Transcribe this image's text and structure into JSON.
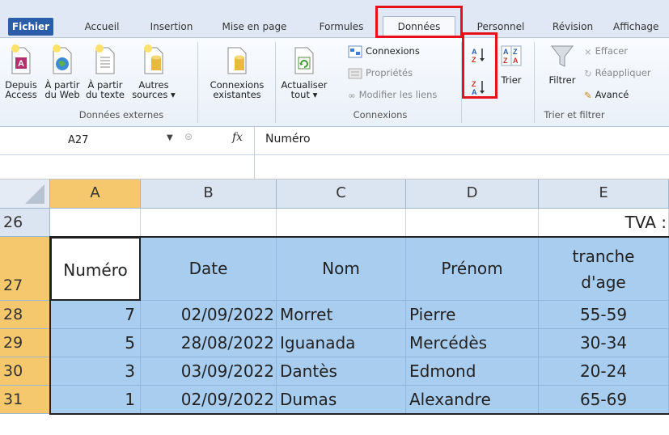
{
  "tabs": {
    "items": [
      "Fichier",
      "Accueil",
      "Insertion",
      "Mise en page",
      "Formules",
      "Données",
      "Personnel",
      "Révision",
      "Affichage"
    ],
    "active": "Données"
  },
  "ribbon": {
    "donnees_externes": {
      "label": "Données externes",
      "buttons": [
        {
          "line1": "Depuis",
          "line2": "Access"
        },
        {
          "line1": "À partir",
          "line2": "du Web"
        },
        {
          "line1": "À partir",
          "line2": "du texte"
        },
        {
          "line1": "Autres",
          "line2": "sources ▾"
        },
        {
          "line1": "Connexions",
          "line2": "existantes"
        }
      ]
    },
    "connexions": {
      "label": "Connexions",
      "refresh": {
        "line1": "Actualiser",
        "line2": "tout ▾"
      },
      "items": [
        "Connexions",
        "Propriétés",
        "Modifier les liens"
      ]
    },
    "trier_filtrer": {
      "label": "Trier et filtrer",
      "sort_button": "Trier",
      "filter_button": "Filtrer",
      "items": [
        "Effacer",
        "Réappliquer",
        "Avancé"
      ]
    }
  },
  "formula_bar": {
    "name_box": "A27",
    "fx": "fx",
    "content": "Numéro"
  },
  "grid": {
    "columns": [
      "A",
      "B",
      "C",
      "D",
      "E"
    ],
    "rows": [
      {
        "num": "26",
        "cells": [
          "",
          "",
          "",
          "",
          "TVA :"
        ]
      },
      {
        "num": "27",
        "cells": [
          "Numéro",
          "Date",
          "Nom",
          "Prénom",
          "tranche d'age"
        ],
        "e_line1": "tranche",
        "e_line2": "d'age"
      },
      {
        "num": "28",
        "cells": [
          "7",
          "02/09/2022",
          "Morret",
          "Pierre",
          "55-59"
        ]
      },
      {
        "num": "29",
        "cells": [
          "5",
          "28/08/2022",
          "Iguanada",
          "Mercédès",
          "30-34"
        ]
      },
      {
        "num": "30",
        "cells": [
          "3",
          "03/09/2022",
          "Dantès",
          "Edmond",
          "20-24"
        ]
      },
      {
        "num": "31",
        "cells": [
          "1",
          "02/09/2022",
          "Dumas",
          "Alexandre",
          "65-69"
        ]
      }
    ]
  },
  "colors": {
    "highlight": "#e8101a",
    "table_fill": "#a9cdef",
    "header_selected": "#f6c86d",
    "file_tab": "#2a5ea8"
  }
}
